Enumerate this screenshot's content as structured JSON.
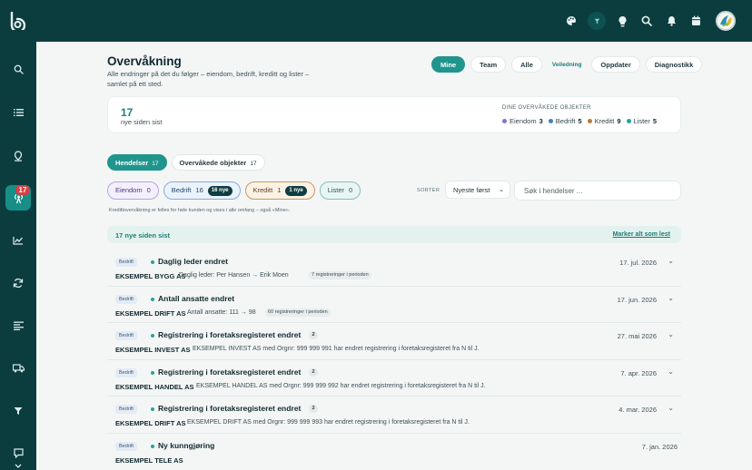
{
  "colors": {
    "brand_dark": "#0b3d3f",
    "accent": "#20958d",
    "eiendom": "#8b6fd6",
    "bedrift": "#3b82c4",
    "kreditt": "#b7793a",
    "lister": "#1fa39a"
  },
  "topbar": {
    "icons": [
      "palette-icon",
      "filter-icon",
      "lightbulb-icon",
      "search-icon",
      "bell-icon",
      "calendar-icon",
      "avatar"
    ]
  },
  "sidebar": {
    "items": [
      "search-icon",
      "list-icon",
      "location-pin-icon",
      "broadcast-icon",
      "chart-icon",
      "refresh-icon",
      "list-lines-icon",
      "truck-icon",
      "filter-icon",
      "chat-icon"
    ],
    "active": "broadcast-icon",
    "badge": "17"
  },
  "header": {
    "title": "Overvåkning",
    "subtitle": "Alle endringer på det du følger – eiendom, bedrift, kreditt og lister – samlet på ett sted."
  },
  "view_tabs": {
    "mine": "Mine",
    "team": "Team",
    "alle": "Alle",
    "veiledning": "Veiledning",
    "oppdater": "Oppdater",
    "diagnostikk": "Diagnostikk",
    "active": "Mine"
  },
  "summary": {
    "count": "17",
    "count_label": "nye siden sist",
    "objects_title": "DINE OVERVÅKEDE OBJEKTER",
    "objects": [
      {
        "label": "Eiendom",
        "count": "3"
      },
      {
        "label": "Bedrift",
        "count": "5"
      },
      {
        "label": "Kreditt",
        "count": "9"
      },
      {
        "label": "Lister",
        "count": "5"
      }
    ]
  },
  "sub_tabs": [
    {
      "label": "Hendelser",
      "count": "17",
      "active": true
    },
    {
      "label": "Overvåkede objekter",
      "count": "17",
      "active": false
    }
  ],
  "filters": {
    "eiendom": {
      "label": "Eiendom",
      "count": "0"
    },
    "bedrift": {
      "label": "Bedrift",
      "count": "16",
      "new": "16 nye"
    },
    "kreditt": {
      "label": "Kreditt",
      "count": "1",
      "new": "1 nye"
    },
    "lister": {
      "label": "Lister",
      "count": "0"
    }
  },
  "sort": {
    "label": "SORTER",
    "value": "Nyeste først"
  },
  "search": {
    "placeholder": "Søk i hendelser ..."
  },
  "note": "Kredittovervåkning er felles for hele kunden og vises i alle omfang – også «Mine».",
  "new_bar": {
    "text": "17 nye siden sist",
    "link": "Marker alt som lest"
  },
  "events": [
    {
      "category": "Bedrift",
      "title": "Daglig leder endret",
      "count": "",
      "date": "17. jul. 2026",
      "company": "EKSEMPEL BYGG AS",
      "desc": "Daglig leder: Per Hansen → Erik Moen",
      "tag": "7 registreringer i perioden"
    },
    {
      "category": "Bedrift",
      "title": "Antall ansatte endret",
      "count": "",
      "date": "17. jun. 2026",
      "company": "EKSEMPEL DRIFT AS",
      "desc": "Antall ansatte: 111 → 98",
      "tag": "60 registreringer i perioden"
    },
    {
      "category": "Bedrift",
      "title": "Registrering i foretaksregisteret endret",
      "count": "2",
      "date": "27. mai 2026",
      "company": "EKSEMPEL INVEST AS",
      "desc": "EKSEMPEL INVEST AS med Orgnr: 999 999 991 har endret registrering i foretaksregisteret fra N til J.",
      "tag": ""
    },
    {
      "category": "Bedrift",
      "title": "Registrering i foretaksregisteret endret",
      "count": "2",
      "date": "7. apr. 2026",
      "company": "EKSEMPEL HANDEL AS",
      "desc": "EKSEMPEL HANDEL AS med Orgnr: 999 999 992 har endret registrering i foretaksregisteret fra N til J.",
      "tag": ""
    },
    {
      "category": "Bedrift",
      "title": "Registrering i foretaksregisteret endret",
      "count": "2",
      "date": "4. mar. 2026",
      "company": "EKSEMPEL DRIFT AS",
      "desc": "EKSEMPEL DRIFT AS med Orgnr: 999 999 993 har endret registrering i foretaksregisteret fra N til J.",
      "tag": ""
    },
    {
      "category": "Bedrift",
      "title": "Ny kunngjøring",
      "count": "",
      "date": "7. jan. 2026",
      "company": "EKSEMPEL TELE AS",
      "desc": "",
      "tag": ""
    }
  ]
}
